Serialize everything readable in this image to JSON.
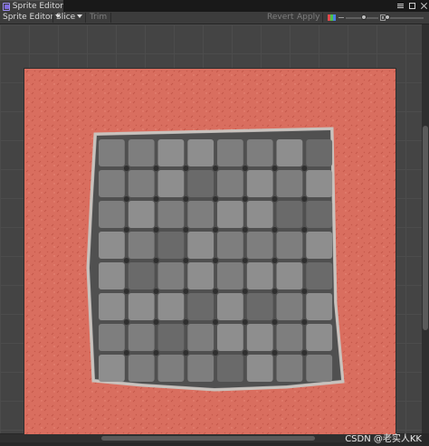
{
  "window": {
    "title": "Sprite Editor",
    "icon": "window-icon",
    "controls": [
      "menu-icon",
      "maximize-icon",
      "close-icon"
    ]
  },
  "toolbar": {
    "mode_label": "Sprite Editor",
    "slice_label": "Slice",
    "trim_label": "Trim",
    "revert_label": "Revert",
    "apply_label": "Apply",
    "channel_icon": "rgb-channel-icon",
    "zoom_slider_level": 0.55,
    "mip_slider_level": 0.0
  },
  "canvas": {
    "sprite_description_icon": "sprite-texture"
  },
  "colors": {
    "ground": "#d96e5f",
    "ground_dark": "#c4584a",
    "stone_light": "#8e8e8e",
    "stone_dark": "#6a6a6a",
    "grout": "#505050",
    "edge": "#b8b8b8"
  },
  "watermark": "CSDN @老实人KK"
}
